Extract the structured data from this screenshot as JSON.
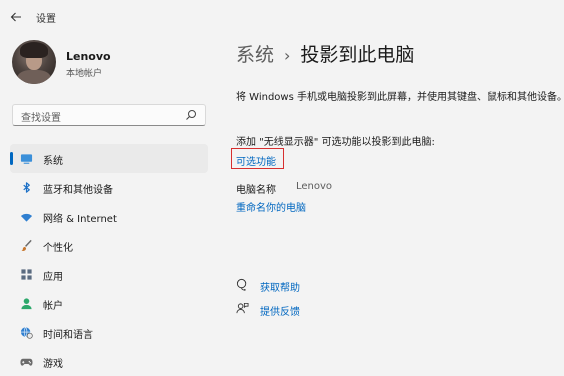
{
  "window": {
    "title": "设置",
    "back_icon": "arrow-left-icon"
  },
  "profile": {
    "name": "Lenovo",
    "account_type": "本地帐户"
  },
  "search": {
    "placeholder": "查找设置",
    "icon": "search-icon"
  },
  "sidebar": {
    "items": [
      {
        "label": "系统",
        "icon": "monitor-icon",
        "active": true
      },
      {
        "label": "蓝牙和其他设备",
        "icon": "bluetooth-icon",
        "active": false
      },
      {
        "label": "网络 & Internet",
        "icon": "wifi-icon",
        "active": false
      },
      {
        "label": "个性化",
        "icon": "brush-icon",
        "active": false
      },
      {
        "label": "应用",
        "icon": "apps-icon",
        "active": false
      },
      {
        "label": "帐户",
        "icon": "person-icon",
        "active": false
      },
      {
        "label": "时间和语言",
        "icon": "globe-clock-icon",
        "active": false
      },
      {
        "label": "游戏",
        "icon": "gamepad-icon",
        "active": false
      }
    ]
  },
  "breadcrumb": {
    "parent": "系统",
    "separator": "›",
    "current": "投影到此电脑"
  },
  "main": {
    "description": "将 Windows 手机或电脑投影到此屏幕，并使用其键盘、鼠标和其他设备。",
    "add_feature_text": "添加 \"无线显示器\" 可选功能以投影到此电脑:",
    "optional_features_link": "可选功能",
    "pc_name_label": "电脑名称",
    "pc_name_value": "Lenovo",
    "rename_link": "重命名你的电脑"
  },
  "help": {
    "get_help": "获取帮助",
    "give_feedback": "提供反馈"
  },
  "colors": {
    "accent": "#0067c0",
    "highlight_box": "#d72f2f",
    "background": "#f3f3f3"
  }
}
